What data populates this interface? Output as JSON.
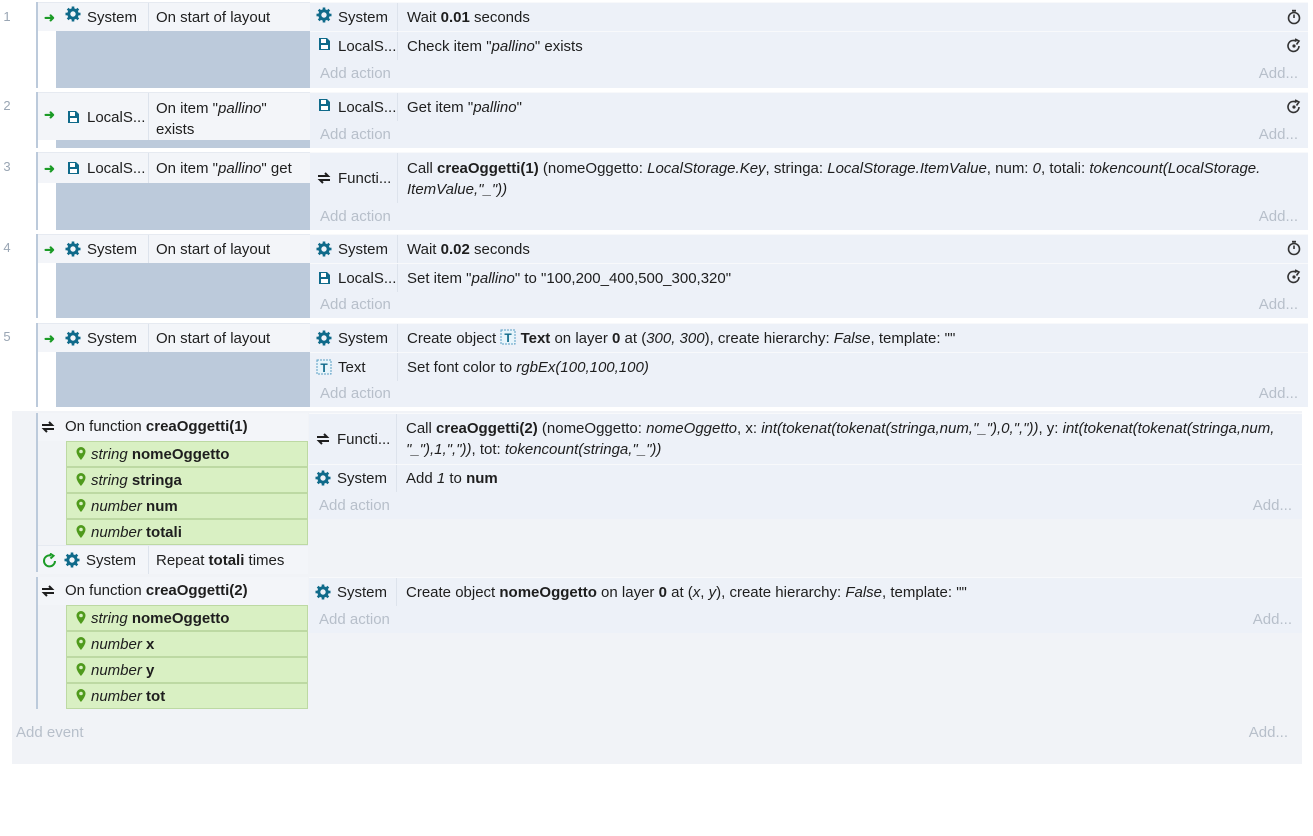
{
  "events": [
    {
      "num": "1",
      "cond_obj": "System",
      "cond_text": "On start of layout",
      "actions": [
        {
          "obj": "System",
          "a": "Wait ",
          "b": "0.01",
          "c": " seconds"
        },
        {
          "obj": "LocalS...",
          "a": "Check item \"",
          "i": "pallino",
          "c": "\" exists"
        }
      ]
    },
    {
      "num": "2",
      "cond_obj": "LocalS...",
      "cond_text_a": "On item \"",
      "cond_text_i": "pallino",
      "cond_text_c": "\"",
      "cond_text_2": "exists",
      "actions": [
        {
          "obj": "LocalS...",
          "a": "Get item \"",
          "i": "pallino",
          "c": "\""
        }
      ]
    },
    {
      "num": "3",
      "cond_obj": "LocalS...",
      "cond_text_a": "On item \"",
      "cond_text_i": "pallino",
      "cond_text_c": "\" get",
      "actions": [
        {
          "obj": "Functi...",
          "line1a": "Call ",
          "line1b": "creaOggetti(1)",
          "line1c": " (nomeOggetto: ",
          "line1d": "LocalStorage.Key",
          "line1e": ", stringa: ",
          "line1f": "LocalStorage.ItemValue",
          "line1g": ", num: ",
          "line1h": "0",
          "line1i": ", totali: ",
          "line1j": "tokencount(LocalStorage.",
          "line2": "ItemValue,\"_\"))"
        }
      ]
    },
    {
      "num": "4",
      "cond_obj": "System",
      "cond_text": "On start of layout",
      "actions": [
        {
          "obj": "System",
          "a": "Wait ",
          "b": "0.02",
          "c": " seconds"
        },
        {
          "obj": "LocalS...",
          "a": "Set item \"",
          "i": "pallino",
          "c": "\" to \"100,200_400,500_300,320\""
        }
      ]
    },
    {
      "num": "5",
      "cond_obj": "System",
      "cond_text": "On start of layout",
      "actions": [
        {
          "obj": "System",
          "a": "Create object ",
          "b": "Text",
          "c": " on layer ",
          "d": "0",
          "e": " at (",
          "f": "300, 300",
          "g": "), create hierarchy: ",
          "h": "False",
          "k": ", template: \"\""
        },
        {
          "obj": "Text",
          "a": "Set font color to ",
          "i": "rgbEx(100,100,100)"
        }
      ]
    }
  ],
  "fn1": {
    "title_a": "On function ",
    "title_b": "creaOggetti(1)",
    "params": [
      {
        "type": "string",
        "name": "nomeOggetto"
      },
      {
        "type": "string",
        "name": "stringa"
      },
      {
        "type": "number",
        "name": "num"
      },
      {
        "type": "number",
        "name": "totali"
      }
    ],
    "repeat_obj": "System",
    "repeat_a": "Repeat ",
    "repeat_b": "totali",
    "repeat_c": " times",
    "act1_obj": "Functi...",
    "act1_l1a": "Call ",
    "act1_l1b": "creaOggetti(2)",
    "act1_l1c": " (nomeOggetto: ",
    "act1_l1d": "nomeOggetto",
    "act1_l1e": ", x: ",
    "act1_l1f": "int(tokenat(tokenat(stringa,num,\"_\"),0,\",\"))",
    "act1_l1g": ", y: ",
    "act1_l1h": "int(tokenat(tokenat(stringa,num,",
    "act1_l2a": "\"_\"),1,\",\"))",
    "act1_l2b": ", tot: ",
    "act1_l2c": "tokencount(stringa,\"_\"))",
    "act2_obj": "System",
    "act2_a": "Add ",
    "act2_i": "1",
    "act2_b": " to ",
    "act2_c": "num"
  },
  "fn2": {
    "title_a": "On function ",
    "title_b": "creaOggetti(2)",
    "params": [
      {
        "type": "string",
        "name": "nomeOggetto"
      },
      {
        "type": "number",
        "name": "x"
      },
      {
        "type": "number",
        "name": "y"
      },
      {
        "type": "number",
        "name": "tot"
      }
    ],
    "act_obj": "System",
    "act_a": "Create object ",
    "act_b": "nomeOggetto",
    "act_c": " on layer ",
    "act_d": "0",
    "act_e": " at (",
    "act_f": "x",
    "act_g": ", ",
    "act_h": "y",
    "act_i": "), create hierarchy: ",
    "act_j": "False",
    "act_k": ", template: \"\""
  },
  "labels": {
    "add_action": "Add action",
    "add_dots": "Add...",
    "add_event": "Add event"
  },
  "icons": {
    "gear": "gear-icon",
    "storage": "storage-icon",
    "function": "function-icon",
    "timer": "stopwatch-icon",
    "async": "async-icon",
    "text": "text-object-icon",
    "pin": "parameter-pin-icon",
    "repeat": "repeat-icon",
    "start": "trigger-arrow-icon"
  },
  "colors": {
    "object_icon": "#0f6a8a",
    "trigger_arrow": "#1b9b26",
    "param_bg": "#d9f0c3",
    "block_bg": "#bccadb",
    "action_bg": "#edf1f8"
  }
}
